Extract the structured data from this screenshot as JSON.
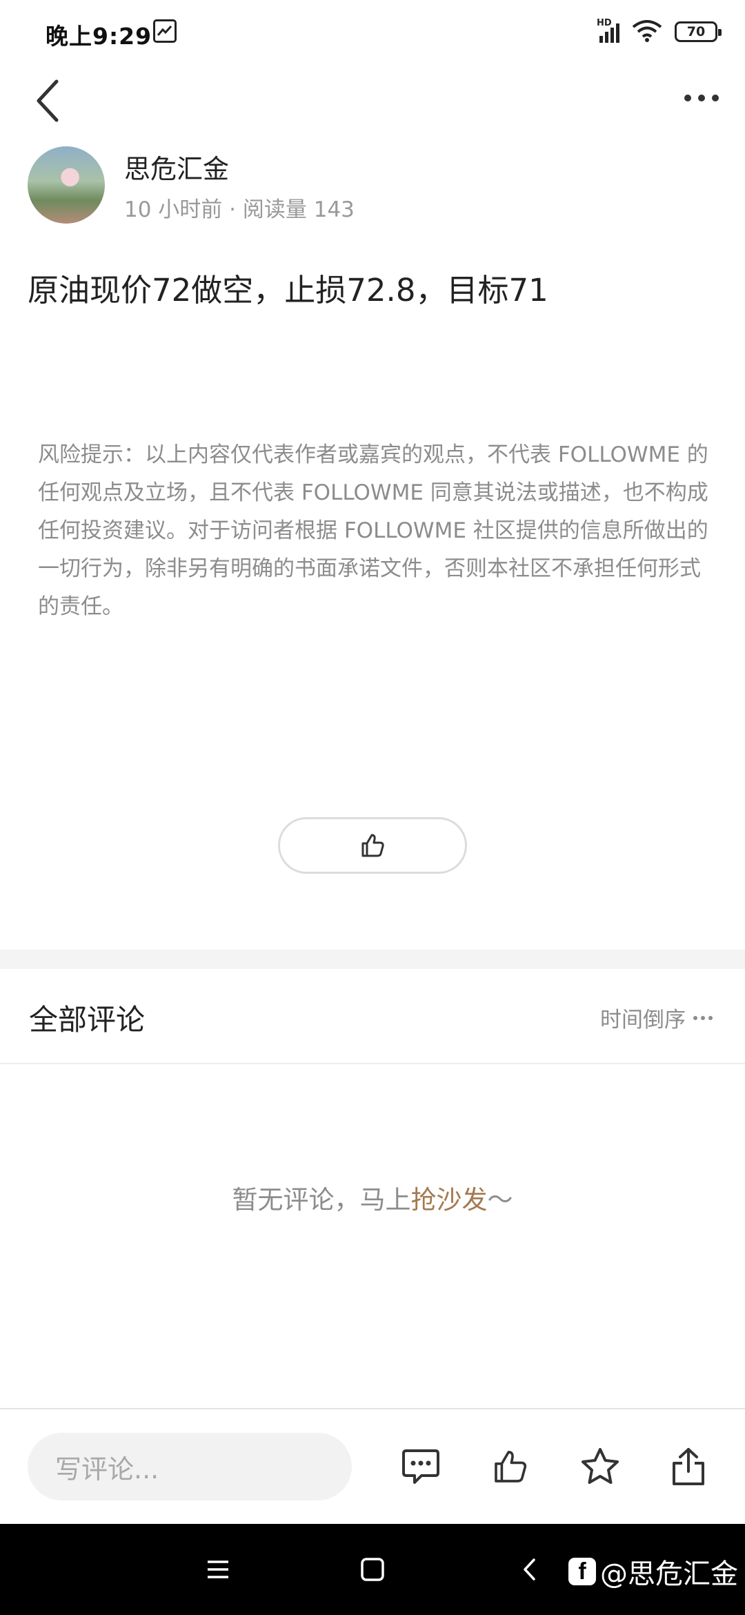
{
  "status_bar": {
    "time": "晚上9:29",
    "network": "HD",
    "battery": "70"
  },
  "header": {
    "back_icon": "chevron-left-icon",
    "more_icon": "more-horizontal-icon"
  },
  "author": {
    "name": "思危汇金",
    "meta": "10 小时前 · 阅读量 143"
  },
  "post": {
    "title": "原油现价72做空，止损72.8，目标71",
    "disclaimer": "风险提示：以上内容仅代表作者或嘉宾的观点，不代表 FOLLOWME 的任何观点及立场，且不代表 FOLLOWME 同意其说法或描述，也不构成任何投资建议。对于访问者根据 FOLLOWME 社区提供的信息所做出的一切行为，除非另有明确的书面承诺文件，否则本社区不承担任何形式的责任。"
  },
  "comments": {
    "title": "全部评论",
    "sort_label": "时间倒序",
    "empty_prefix": "暂无评论，马上",
    "empty_link": "抢沙发",
    "empty_suffix": "～"
  },
  "bottom_bar": {
    "input_placeholder": "写评论..."
  },
  "watermark": {
    "text": "@思危汇金"
  },
  "colors": {
    "accent_link": "#a37a4f",
    "muted_text": "#8c8c8c",
    "divider": "#ededed",
    "nav_bar": "#000000"
  }
}
